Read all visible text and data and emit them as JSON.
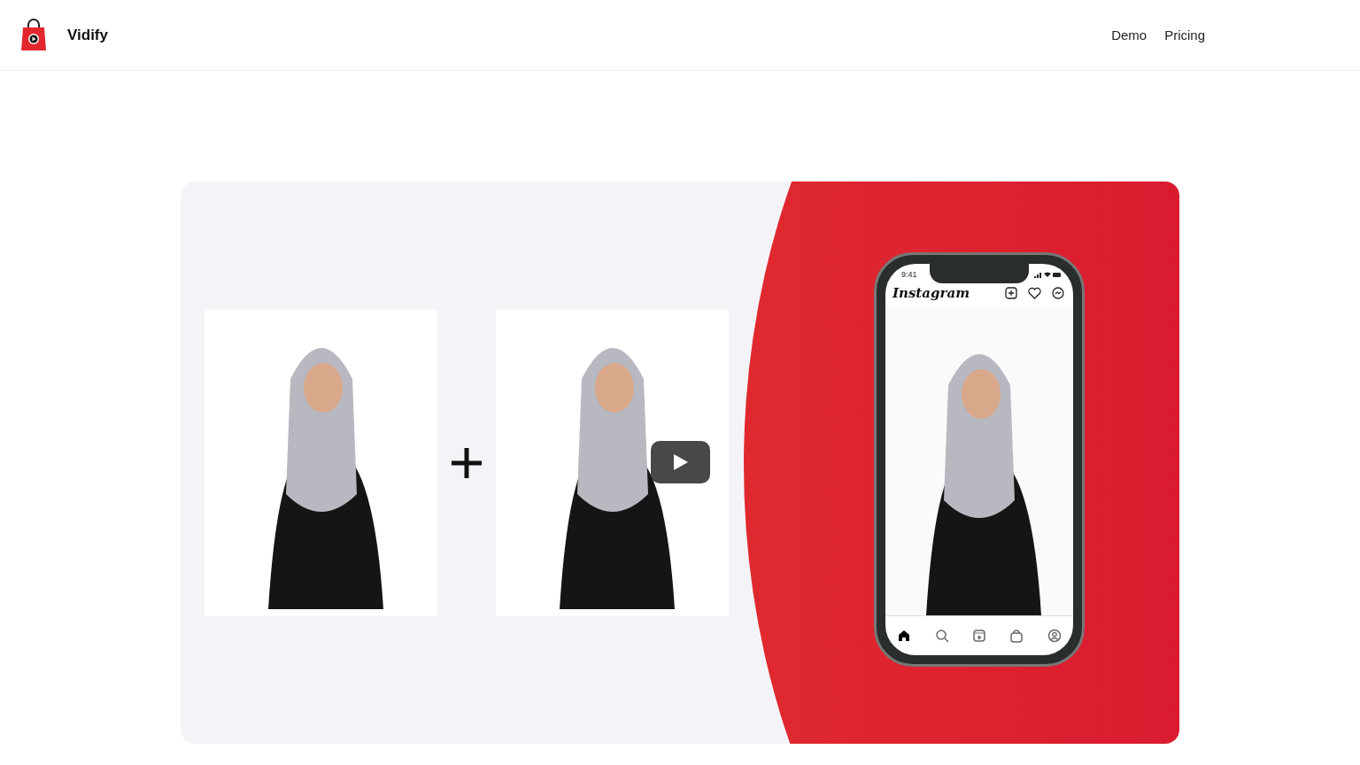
{
  "header": {
    "brand": "Vidify",
    "nav": [
      "Demo",
      "Pricing"
    ]
  },
  "hero": {
    "phone": {
      "time": "9:41",
      "app_title": "Instagram",
      "tabs": [
        {
          "kind": "home",
          "selected": true
        },
        {
          "kind": "search",
          "selected": false
        },
        {
          "kind": "reels",
          "selected": false
        },
        {
          "kind": "shop",
          "selected": false
        },
        {
          "kind": "profile",
          "selected": false
        }
      ]
    }
  }
}
